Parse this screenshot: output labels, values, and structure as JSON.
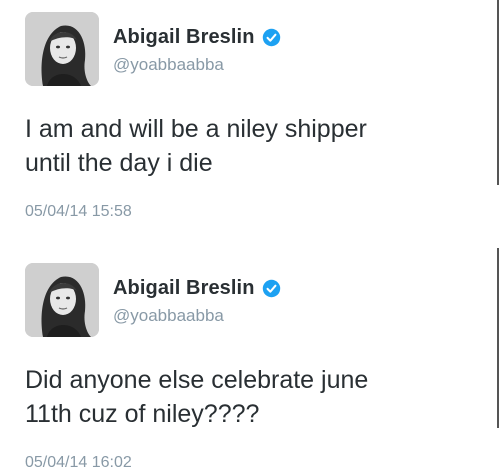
{
  "tweets": [
    {
      "author": {
        "name": "Abigail Breslin",
        "handle": "@yoabbaabba",
        "verified": true
      },
      "text_lines": [
        "I am and will be a niley shipper",
        "until the day i die"
      ],
      "timestamp": "05/04/14 15:58"
    },
    {
      "author": {
        "name": "Abigail Breslin",
        "handle": "@yoabbaabba",
        "verified": true
      },
      "text_lines": [
        "Did anyone else celebrate june",
        "11th cuz of niley????"
      ],
      "timestamp": "05/04/14 16:02"
    }
  ],
  "colors": {
    "name": "#292f33",
    "secondary": "#8899a6",
    "verified_badge": "#1da1f2"
  },
  "icons": {
    "verified": "verified-badge-icon"
  }
}
